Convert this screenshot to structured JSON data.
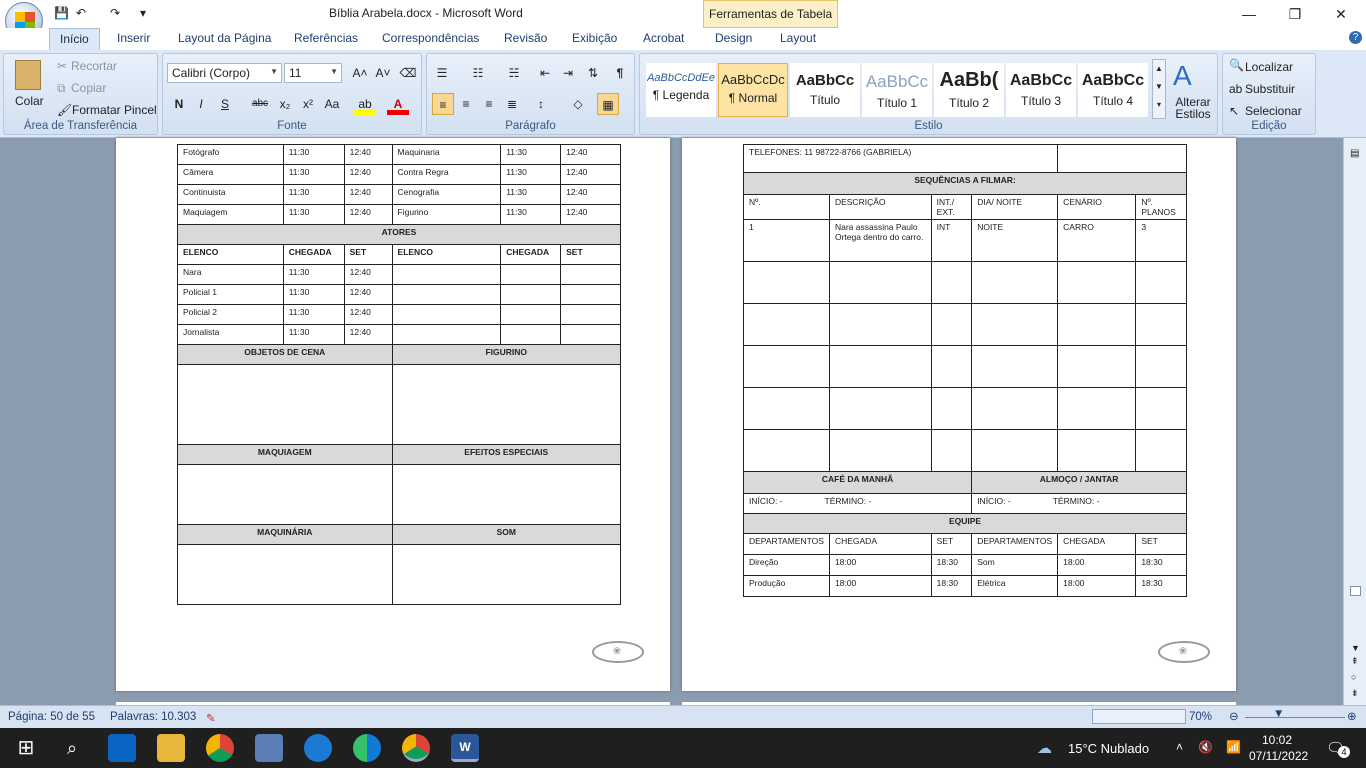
{
  "window": {
    "title": "Bíblia Arabela.docx - Microsoft Word",
    "context_tab": "Ferramentas de Tabela"
  },
  "qat": {
    "save": "💾",
    "undo": "↶",
    "redo": "↷",
    "more": "▾"
  },
  "controls": {
    "minimize": "—",
    "maximize": "❐",
    "close": "✕"
  },
  "tabs": [
    "Início",
    "Inserir",
    "Layout da Página",
    "Referências",
    "Correspondências",
    "Revisão",
    "Exibição",
    "Acrobat",
    "Design",
    "Layout"
  ],
  "help": "?",
  "clipboard": {
    "paste": "Colar",
    "cut": "Recortar",
    "copy": "Copiar",
    "painter": "Formatar Pincel",
    "label": "Área de Transferência"
  },
  "font": {
    "name": "Calibri (Corpo)",
    "size": "11",
    "label": "Fonte",
    "bold": "N",
    "italic": "I",
    "underline": "S",
    "strike": "abc",
    "sub": "x₂",
    "sup": "x²",
    "case": "Aa",
    "grow": "A˄",
    "shrink": "A˅"
  },
  "paragraph": {
    "label": "Parágrafo",
    "pilcrow": "¶"
  },
  "styles": {
    "label": "Estilo",
    "items": [
      {
        "preview": "AaBbCcDdEe",
        "name": "¶ Legenda"
      },
      {
        "preview": "AaBbCcDc",
        "name": "¶ Normal"
      },
      {
        "preview": "AaBbCc",
        "name": "Título"
      },
      {
        "preview": "AaBbCc",
        "name": "Título 1"
      },
      {
        "preview": "AaBb(",
        "name": "Título 2"
      },
      {
        "preview": "AaBbCc",
        "name": "Título 3"
      },
      {
        "preview": "AaBbCc",
        "name": "Título 4"
      }
    ],
    "change": "Alterar Estilos"
  },
  "editing": {
    "label": "Edição",
    "find": "Localizar",
    "replace": "Substituir",
    "select": "Selecionar"
  },
  "left_page": {
    "crew_rows": [
      [
        "Fotógrafo",
        "11:30",
        "12:40",
        "Maquinaria",
        "11:30",
        "12:40"
      ],
      [
        "Câmera",
        "11:30",
        "12:40",
        "Contra Regra",
        "11:30",
        "12:40"
      ],
      [
        "Continuista",
        "11:30",
        "12:40",
        "Cenografia",
        "11:30",
        "12:40"
      ],
      [
        "Maquiagem",
        "11:30",
        "12:40",
        "Figurino",
        "11:30",
        "12:40"
      ]
    ],
    "actors_title": "ATORES",
    "actor_headers": [
      "ELENCO",
      "CHEGADA",
      "SET",
      "ELENCO",
      "CHEGADA",
      "SET"
    ],
    "actor_rows": [
      [
        "Nara",
        "11:30",
        "12:40",
        "",
        "",
        ""
      ],
      [
        "Policial 1",
        "11:30",
        "12:40",
        "",
        "",
        ""
      ],
      [
        "Policial 2",
        "11:30",
        "12:40",
        "",
        "",
        ""
      ],
      [
        "Jornalista",
        "11:30",
        "12:40",
        "",
        "",
        ""
      ]
    ],
    "sections": [
      [
        "OBJETOS DE CENA",
        "FIGURINO"
      ],
      [
        "MAQUIAGEM",
        "EFEITOS  ESPECIAIS"
      ],
      [
        "MAQUINÁRIA",
        "SOM"
      ]
    ]
  },
  "right_page": {
    "phones": "TELEFONES: 11 98722-8766  (GABRIELA)",
    "seq_title": "SEQUÊNCIAS A FILMAR:",
    "seq_headers": [
      "Nº.",
      "DESCRIÇÃO",
      "INT./ EXT.",
      "DIA/ NOITE",
      "CENÁRIO",
      "Nº. PLANOS"
    ],
    "seq_rows": [
      [
        "1",
        "Nara assassina Paulo Ortega dentro do carro.",
        "INT",
        "NOITE",
        "CARRO",
        "3"
      ]
    ],
    "meals": [
      "CAFÉ DA MANHÃ",
      "ALMOÇO / JANTAR"
    ],
    "meal_start": "INÍCIO: -",
    "meal_end": "TÉRMINO: -",
    "team_title": "EQUIPE",
    "team_headers": [
      "DEPARTAMENTOS",
      "CHEGADA",
      "SET",
      "DEPARTAMENTOS",
      "CHEGADA",
      "SET"
    ],
    "team_rows": [
      [
        "Direção",
        "18:00",
        "18:30",
        "Som",
        "18:00",
        "18:30"
      ],
      [
        "Produção",
        "18:00",
        "18:30",
        "Elétrica",
        "18:00",
        "18:30"
      ]
    ]
  },
  "status": {
    "page": "Página: 50 de 55",
    "words": "Palavras: 10.303",
    "zoom": "70%"
  },
  "taskbar": {
    "weather": "15°C  Nublado",
    "time": "10:02",
    "date": "07/11/2022",
    "notif": "4"
  }
}
